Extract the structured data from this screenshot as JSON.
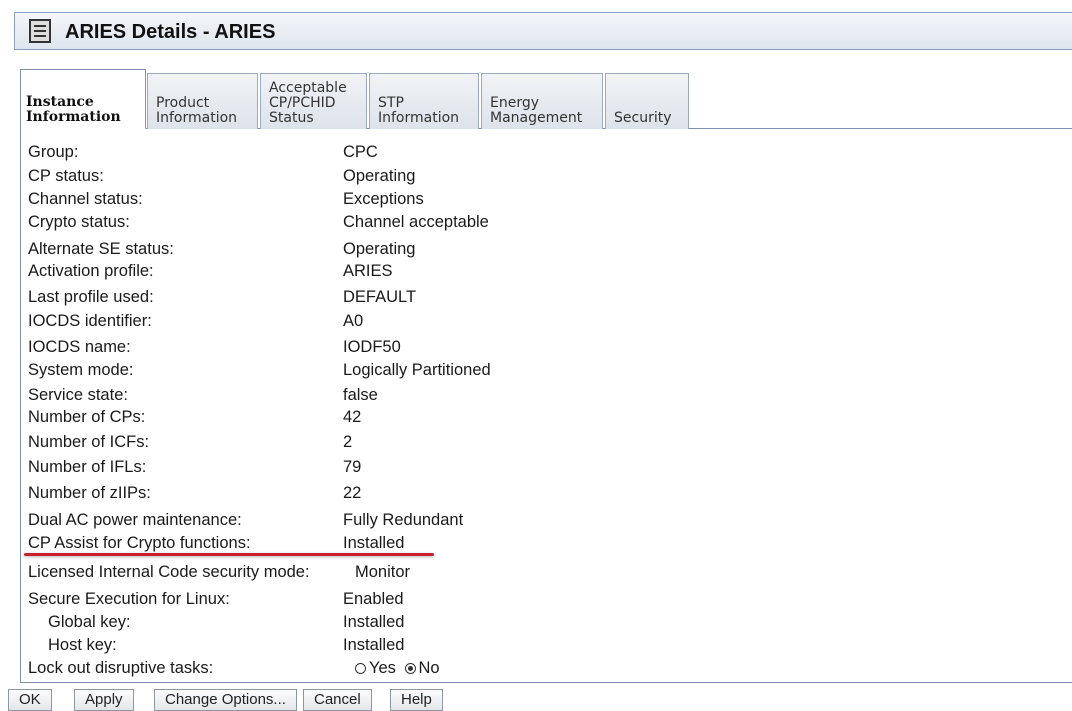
{
  "window": {
    "title": "ARIES Details - ARIES",
    "icon": "window-icon"
  },
  "tabs": [
    {
      "label": "Instance\nInformation",
      "active": true
    },
    {
      "label": "Product\nInformation",
      "active": false
    },
    {
      "label": "Acceptable\nCP/PCHID\nStatus",
      "active": false
    },
    {
      "label": "STP\nInformation",
      "active": false
    },
    {
      "label": "Energy\nManagement",
      "active": false
    },
    {
      "label": "Security",
      "active": false
    }
  ],
  "details": [
    {
      "label": "Group:",
      "value": "CPC"
    },
    {
      "label": "CP status:",
      "value": "Operating"
    },
    {
      "label": "Channel status:",
      "value": "Exceptions"
    },
    {
      "label": "Crypto status:",
      "value": "Channel acceptable"
    },
    {
      "label": "Alternate SE status:",
      "value": "Operating"
    },
    {
      "label": "Activation profile:",
      "value": "ARIES"
    },
    {
      "label": "Last profile used:",
      "value": "DEFAULT"
    },
    {
      "label": "IOCDS identifier:",
      "value": "A0"
    },
    {
      "label": "IOCDS name:",
      "value": "IODF50"
    },
    {
      "label": "System mode:",
      "value": "Logically Partitioned"
    },
    {
      "label": "Service state:",
      "value": "false"
    },
    {
      "label": "Number of CPs:",
      "value": "42"
    },
    {
      "label": "Number of ICFs:",
      "value": "2"
    },
    {
      "label": "Number of IFLs:",
      "value": "79"
    },
    {
      "label": "Number of zIIPs:",
      "value": "22"
    },
    {
      "label": "Dual AC power maintenance:",
      "value": "Fully Redundant"
    },
    {
      "label": "CP Assist for Crypto functions:",
      "value": "Installed"
    },
    {
      "label": "Licensed Internal Code security mode:",
      "value": "Monitor"
    },
    {
      "label": "Secure Execution for Linux:",
      "value": "Enabled"
    },
    {
      "label": "Global key:",
      "value": "Installed"
    },
    {
      "label": "Host key:",
      "value": "Installed"
    }
  ],
  "lockout": {
    "label": "Lock out disruptive tasks:",
    "options": [
      "Yes",
      "No"
    ],
    "selected": "No"
  },
  "highlight_color": "#c8202d",
  "buttons": [
    "OK",
    "Apply",
    "Change Options...",
    "Cancel",
    "Help"
  ]
}
